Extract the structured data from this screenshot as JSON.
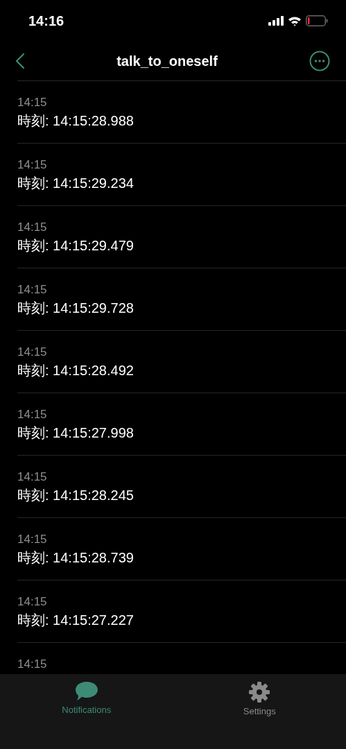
{
  "status_bar": {
    "time": "14:16"
  },
  "header": {
    "title": "talk_to_oneself"
  },
  "messages": [
    {
      "time": "14:15",
      "text": "時刻: 14:15:28.988"
    },
    {
      "time": "14:15",
      "text": "時刻: 14:15:29.234"
    },
    {
      "time": "14:15",
      "text": "時刻: 14:15:29.479"
    },
    {
      "time": "14:15",
      "text": "時刻: 14:15:29.728"
    },
    {
      "time": "14:15",
      "text": "時刻: 14:15:28.492"
    },
    {
      "time": "14:15",
      "text": "時刻: 14:15:27.998"
    },
    {
      "time": "14:15",
      "text": "時刻: 14:15:28.245"
    },
    {
      "time": "14:15",
      "text": "時刻: 14:15:28.739"
    },
    {
      "time": "14:15",
      "text": "時刻: 14:15:27.227"
    },
    {
      "time": "14:15"
    }
  ],
  "tabs": [
    {
      "kind": "chat",
      "label": "Notifications",
      "selected": true
    },
    {
      "kind": "gear",
      "label": "Settings",
      "selected": false
    }
  ]
}
